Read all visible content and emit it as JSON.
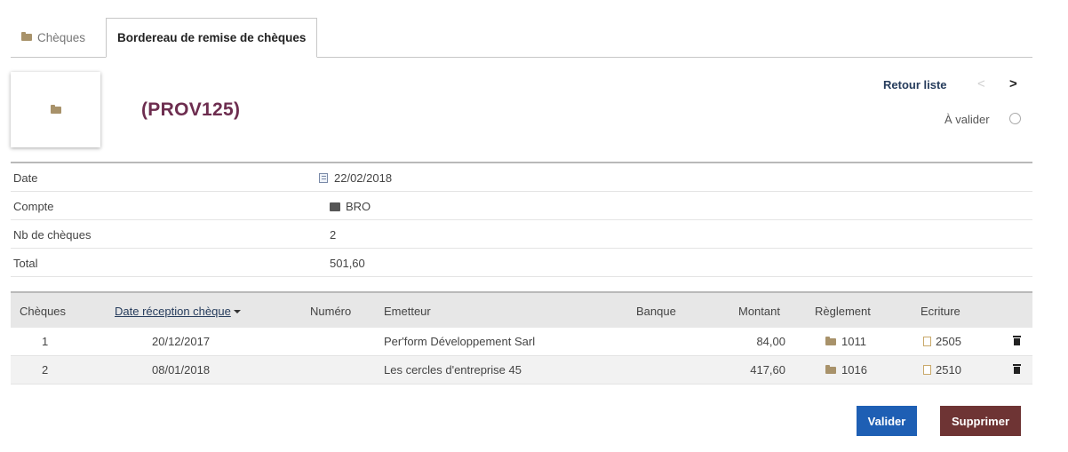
{
  "tabs": [
    {
      "label": "Chèques",
      "icon": "folder-icon",
      "active": false
    },
    {
      "label": "Bordereau de remise de chèques",
      "active": true
    }
  ],
  "header": {
    "ref": "(PROV125)",
    "retour_liste": "Retour liste",
    "prev": "<",
    "next": ">",
    "status": "À valider"
  },
  "fields": [
    {
      "label": "Date",
      "value": "22/02/2018"
    },
    {
      "label": "Compte",
      "value": "BRO"
    },
    {
      "label": "Nb de chèques",
      "value": "2"
    },
    {
      "label": "Total",
      "value": "501,60"
    }
  ],
  "table": {
    "columns": [
      "Chèques",
      "Date réception chèque",
      "Numéro",
      "Emetteur",
      "Banque",
      "Montant",
      "Règlement",
      "Ecriture"
    ],
    "rows": [
      {
        "cheque": "1",
        "date": "20/12/2017",
        "numero": "",
        "emetteur": "Per'form Développement Sarl",
        "banque": "",
        "montant": "84,00",
        "reglement": "1011",
        "ecriture": "2505"
      },
      {
        "cheque": "2",
        "date": "08/01/2018",
        "numero": "",
        "emetteur": "Les cercles d'entreprise 45",
        "banque": "",
        "montant": "417,60",
        "reglement": "1016",
        "ecriture": "2510"
      }
    ]
  },
  "actions": {
    "valider": "Valider",
    "supprimer": "Supprimer"
  },
  "colors": {
    "ref_title": "#6d2d4f",
    "valider_button": "#1e5fb4",
    "supprimer_button": "#6e3434",
    "link": "#263c5c"
  }
}
